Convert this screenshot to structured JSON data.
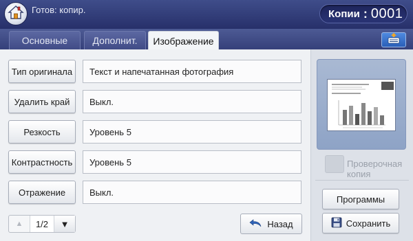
{
  "status": {
    "text": "Готов: копир."
  },
  "copies": {
    "label": "Копии",
    "separator": ":",
    "value": "0001"
  },
  "tabs": [
    {
      "label": "Основные",
      "active": false
    },
    {
      "label": "Дополнит.",
      "active": false
    },
    {
      "label": "Изображение",
      "active": true
    }
  ],
  "options": [
    {
      "label": "Тип оригинала",
      "value": "Текст и напечатанная фотография"
    },
    {
      "label": "Удалить край",
      "value": "Выкл."
    },
    {
      "label": "Резкость",
      "value": "Уровень 5"
    },
    {
      "label": "Контрастность",
      "value": "Уровень 5"
    },
    {
      "label": "Отражение",
      "value": "Выкл."
    }
  ],
  "pager": {
    "current": "1/2"
  },
  "back_button": {
    "label": "Назад"
  },
  "proof_copy": {
    "label": "Проверочная копия",
    "checked": false,
    "enabled": false
  },
  "programs_button": {
    "label": "Программы"
  },
  "save_button": {
    "label": "Сохранить"
  },
  "colors": {
    "accent": "#2a3475",
    "header": "#3f4d8a"
  }
}
